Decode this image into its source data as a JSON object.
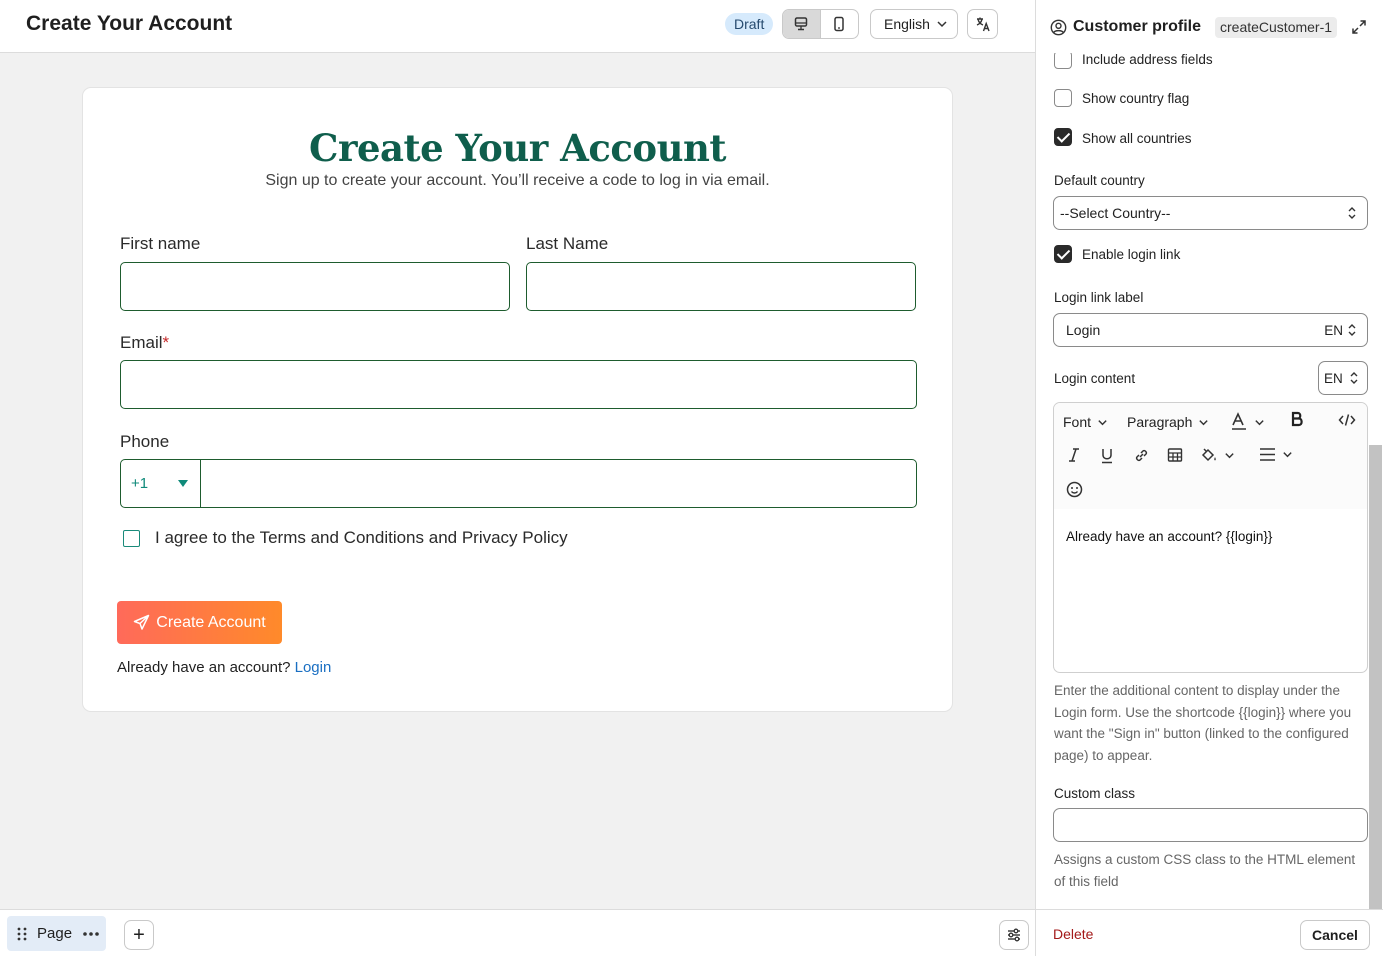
{
  "header": {
    "title": "Create Your Account",
    "status_badge": "Draft",
    "language": "English"
  },
  "form": {
    "title": "Create Your Account",
    "subtitle": "Sign up to create your account. You’ll receive a code to log in via email.",
    "first_name_label": "First name",
    "last_name_label": "Last Name",
    "email_label": "Email",
    "email_required_mark": "*",
    "phone_label": "Phone",
    "phone_code": "+1",
    "terms_label": "I agree to the Terms and Conditions and Privacy Policy",
    "submit_label": "Create Account",
    "login_prompt": "Already have an account?",
    "login_link": "Login"
  },
  "bottombar": {
    "page_label": "Page",
    "add_label": "+"
  },
  "panel": {
    "title": "Customer profile",
    "id_badge": "createCustomer-1",
    "include_address_label": "Include address fields",
    "include_address_checked": false,
    "show_flag_label": "Show country flag",
    "show_flag_checked": false,
    "show_all_label": "Show all countries",
    "show_all_checked": true,
    "default_country_label": "Default country",
    "default_country_value": "--Select Country--",
    "enable_login_label": "Enable login link",
    "enable_login_checked": true,
    "login_link_label_label": "Login link label",
    "login_link_label_value": "Login",
    "login_link_label_lang": "EN",
    "login_content_label": "Login content",
    "login_content_lang": "EN",
    "toolbar": {
      "font": "Font",
      "paragraph": "Paragraph"
    },
    "editor_content": "Already have an account? {{login}}",
    "login_help": "Enter the additional content to display under the Login form. Use the shortcode {{login}} where you want the \"Sign in\" button (linked to the configured page) to appear.",
    "custom_class_label": "Custom class",
    "custom_class_value": "",
    "custom_class_help": "Assigns a custom CSS class to the HTML element of this field",
    "delete_label": "Delete",
    "cancel_label": "Cancel"
  },
  "colors": {
    "title_green": "#0f5e4c",
    "input_border": "#1e5c2e",
    "button_gradient_start": "#ff6a5a",
    "button_gradient_end": "#ff8a2a",
    "link_blue": "#1a6fc2",
    "delete_red": "#a31919"
  }
}
